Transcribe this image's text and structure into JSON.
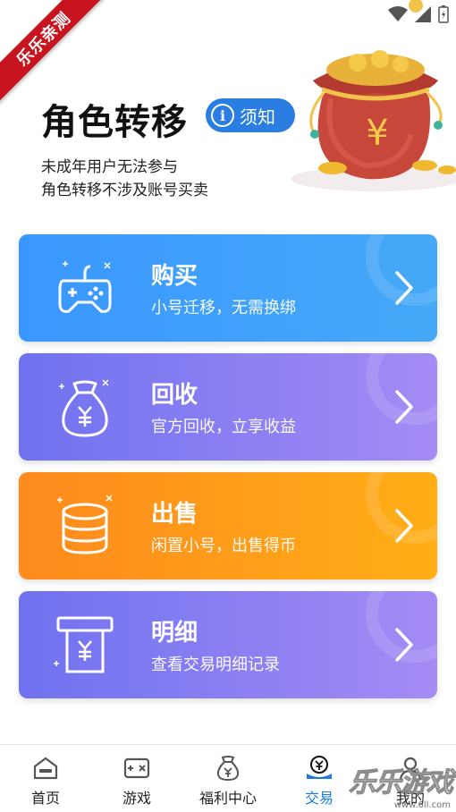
{
  "ribbon": {
    "text": "乐乐亲测"
  },
  "hero": {
    "title": "角色转移",
    "notice_icon": "i",
    "notice_label": "须知",
    "sub_line1": "未成年用户无法参与",
    "sub_line2": "角色转移不涉及账号买卖"
  },
  "cards": [
    {
      "title": "购买",
      "subtitle": "小号迁移，无需换绑",
      "icon": "gamepad-icon",
      "color": "#3a97ff"
    },
    {
      "title": "回收",
      "subtitle": "官方回收，立享收益",
      "icon": "money-bag-icon",
      "color": "#8a7ff2"
    },
    {
      "title": "出售",
      "subtitle": "闲置小号，出售得币",
      "icon": "coin-stack-icon",
      "color": "#ff9a1a"
    },
    {
      "title": "明细",
      "subtitle": "查看交易明细记录",
      "icon": "receipt-icon",
      "color": "#8a7ff2"
    }
  ],
  "nav": {
    "items": [
      {
        "label": "首页",
        "icon": "home-icon"
      },
      {
        "label": "游戏",
        "icon": "game-icon"
      },
      {
        "label": "福利中心",
        "icon": "welfare-bag-icon"
      },
      {
        "label": "交易",
        "icon": "trade-icon",
        "active": true
      },
      {
        "label": "我的",
        "icon": "profile-icon"
      }
    ],
    "active_color": "#1e7be0"
  },
  "watermark": {
    "text": "乐乐游戏",
    "url": "www.6ll.com"
  }
}
